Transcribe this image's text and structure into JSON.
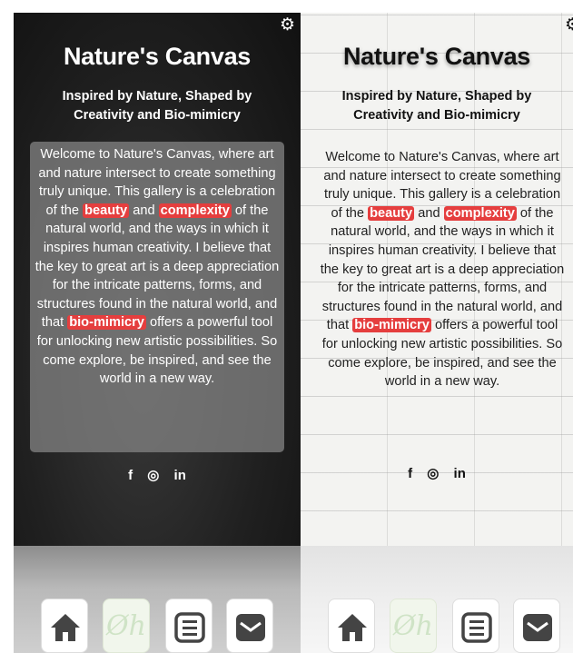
{
  "app": {
    "title": "Nature's Canvas",
    "subtitle": "Inspired by Nature, Shaped by Creativity and Bio-mimicry"
  },
  "intro": {
    "part1": "Welcome to Nature's Canvas, where art and nature intersect to create something truly unique. This gallery is a celebration of the ",
    "highlight1": "beauty",
    "part2": " and ",
    "highlight2": "complexity",
    "part3": " of the natural world, and the ways in which it inspires human creativity. I believe that the key to great art is a deep appreciation for the intricate patterns, forms, and structures found in the natural world, and that ",
    "highlight3": "bio-mimicry",
    "part4": " offers a powerful tool for unlocking new artistic possibilities. So come explore, be inspired, and see the world in a new way."
  },
  "social": {
    "facebook": "f",
    "instagram": "◎",
    "linkedin": "in"
  },
  "nav": {
    "logo_glyph": "Øh",
    "items": [
      "home-icon",
      "logo-icon",
      "menu-icon",
      "mail-icon"
    ]
  },
  "icons": {
    "settings": "gear-icon"
  },
  "colors": {
    "highlight": "#e53e3e",
    "dark_overlay": "#808080",
    "dark_bg": "#202020",
    "light_bg": "#f3f3f1",
    "nav_icon": "#444444"
  }
}
